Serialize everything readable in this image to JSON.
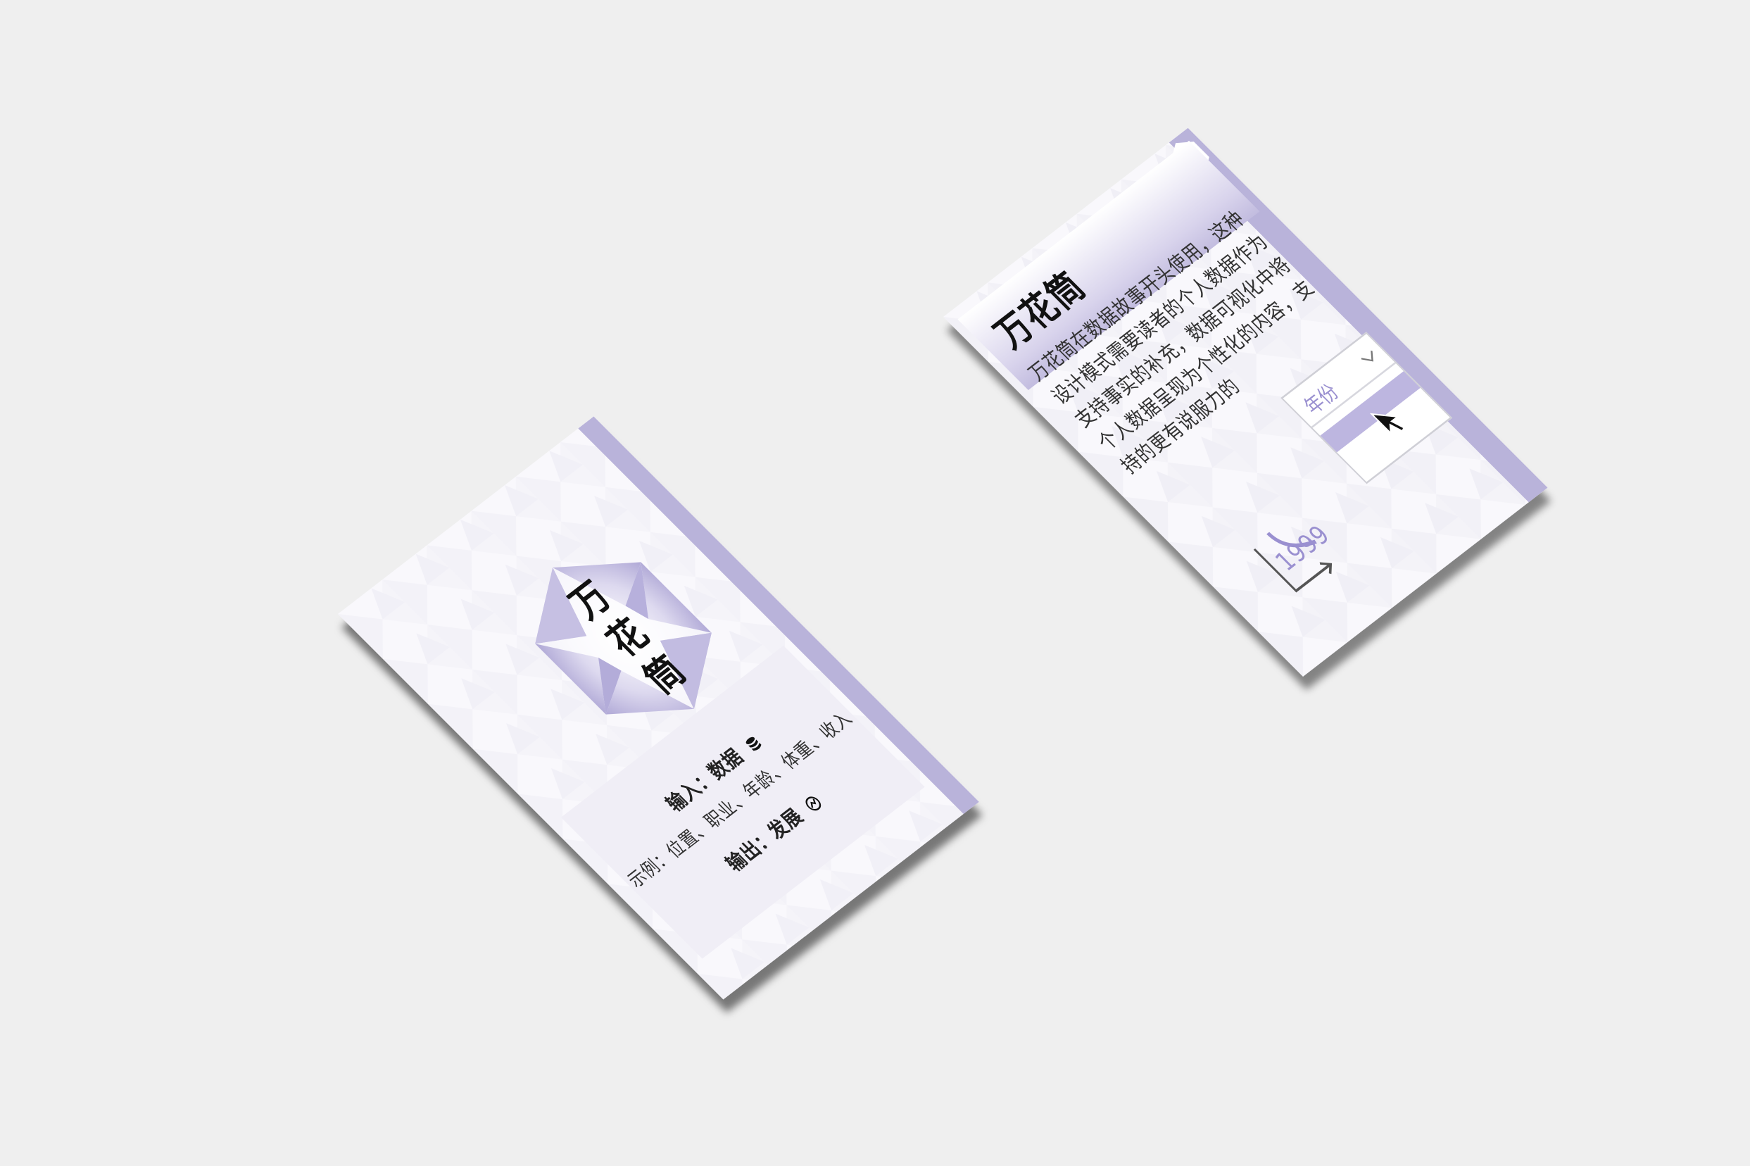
{
  "background_color": "#efefef",
  "accent_color": "#b9b3da",
  "back_card": {
    "title": "万花筒",
    "body": "万花筒在数据故事开头使用，这种设计模式需要读者的个人数据作为支持事实的补充，数据可视化中将个人数据呈现为个性化的内容，支持的更有说服力的",
    "dropdown_label": "年份",
    "dropdown_icon": "chevron-down-icon",
    "cursor_icon": "arrow-cursor-icon",
    "year": "1999",
    "corner_icon": "kaleidoscope-star-icon"
  },
  "front_card": {
    "emblem_chars": [
      "万",
      "花",
      "筒"
    ],
    "input_label": "输入：",
    "input_value": "数据",
    "input_icon": "database-icon",
    "example": "示例：位置、职业、年龄、体重、收入",
    "output_label": "输出：",
    "output_value": "发展",
    "output_icon": "development-icon"
  }
}
